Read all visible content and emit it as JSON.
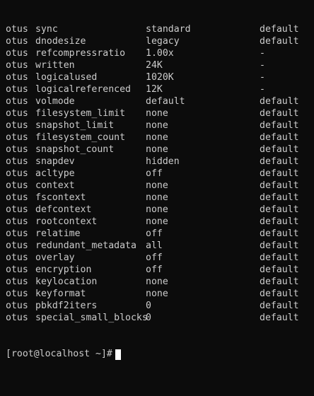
{
  "terminal": {
    "rows": [
      [
        "otus",
        "sync",
        "standard",
        "default"
      ],
      [
        "otus",
        "dnodesize",
        "legacy",
        "default"
      ],
      [
        "otus",
        "refcompressratio",
        "1.00x",
        "-"
      ],
      [
        "otus",
        "written",
        "24K",
        "-"
      ],
      [
        "otus",
        "logicalused",
        "1020K",
        "-"
      ],
      [
        "otus",
        "logicalreferenced",
        "12K",
        "-"
      ],
      [
        "otus",
        "volmode",
        "default",
        "default"
      ],
      [
        "otus",
        "filesystem_limit",
        "none",
        "default"
      ],
      [
        "otus",
        "snapshot_limit",
        "none",
        "default"
      ],
      [
        "otus",
        "filesystem_count",
        "none",
        "default"
      ],
      [
        "otus",
        "snapshot_count",
        "none",
        "default"
      ],
      [
        "otus",
        "snapdev",
        "hidden",
        "default"
      ],
      [
        "otus",
        "acltype",
        "off",
        "default"
      ],
      [
        "otus",
        "context",
        "none",
        "default"
      ],
      [
        "otus",
        "fscontext",
        "none",
        "default"
      ],
      [
        "otus",
        "defcontext",
        "none",
        "default"
      ],
      [
        "otus",
        "rootcontext",
        "none",
        "default"
      ],
      [
        "otus",
        "relatime",
        "off",
        "default"
      ],
      [
        "otus",
        "redundant_metadata",
        "all",
        "default"
      ],
      [
        "otus",
        "overlay",
        "off",
        "default"
      ],
      [
        "otus",
        "encryption",
        "off",
        "default"
      ],
      [
        "otus",
        "keylocation",
        "none",
        "default"
      ],
      [
        "otus",
        "keyformat",
        "none",
        "default"
      ],
      [
        "otus",
        "pbkdf2iters",
        "0",
        "default"
      ],
      [
        "otus",
        "special_small_blocks",
        "0",
        "default"
      ]
    ],
    "prompt": "[root@localhost ~]#",
    "colors": {
      "background": "#0c0c0c",
      "foreground": "#cccccc",
      "cursor": "#ffffff"
    }
  }
}
